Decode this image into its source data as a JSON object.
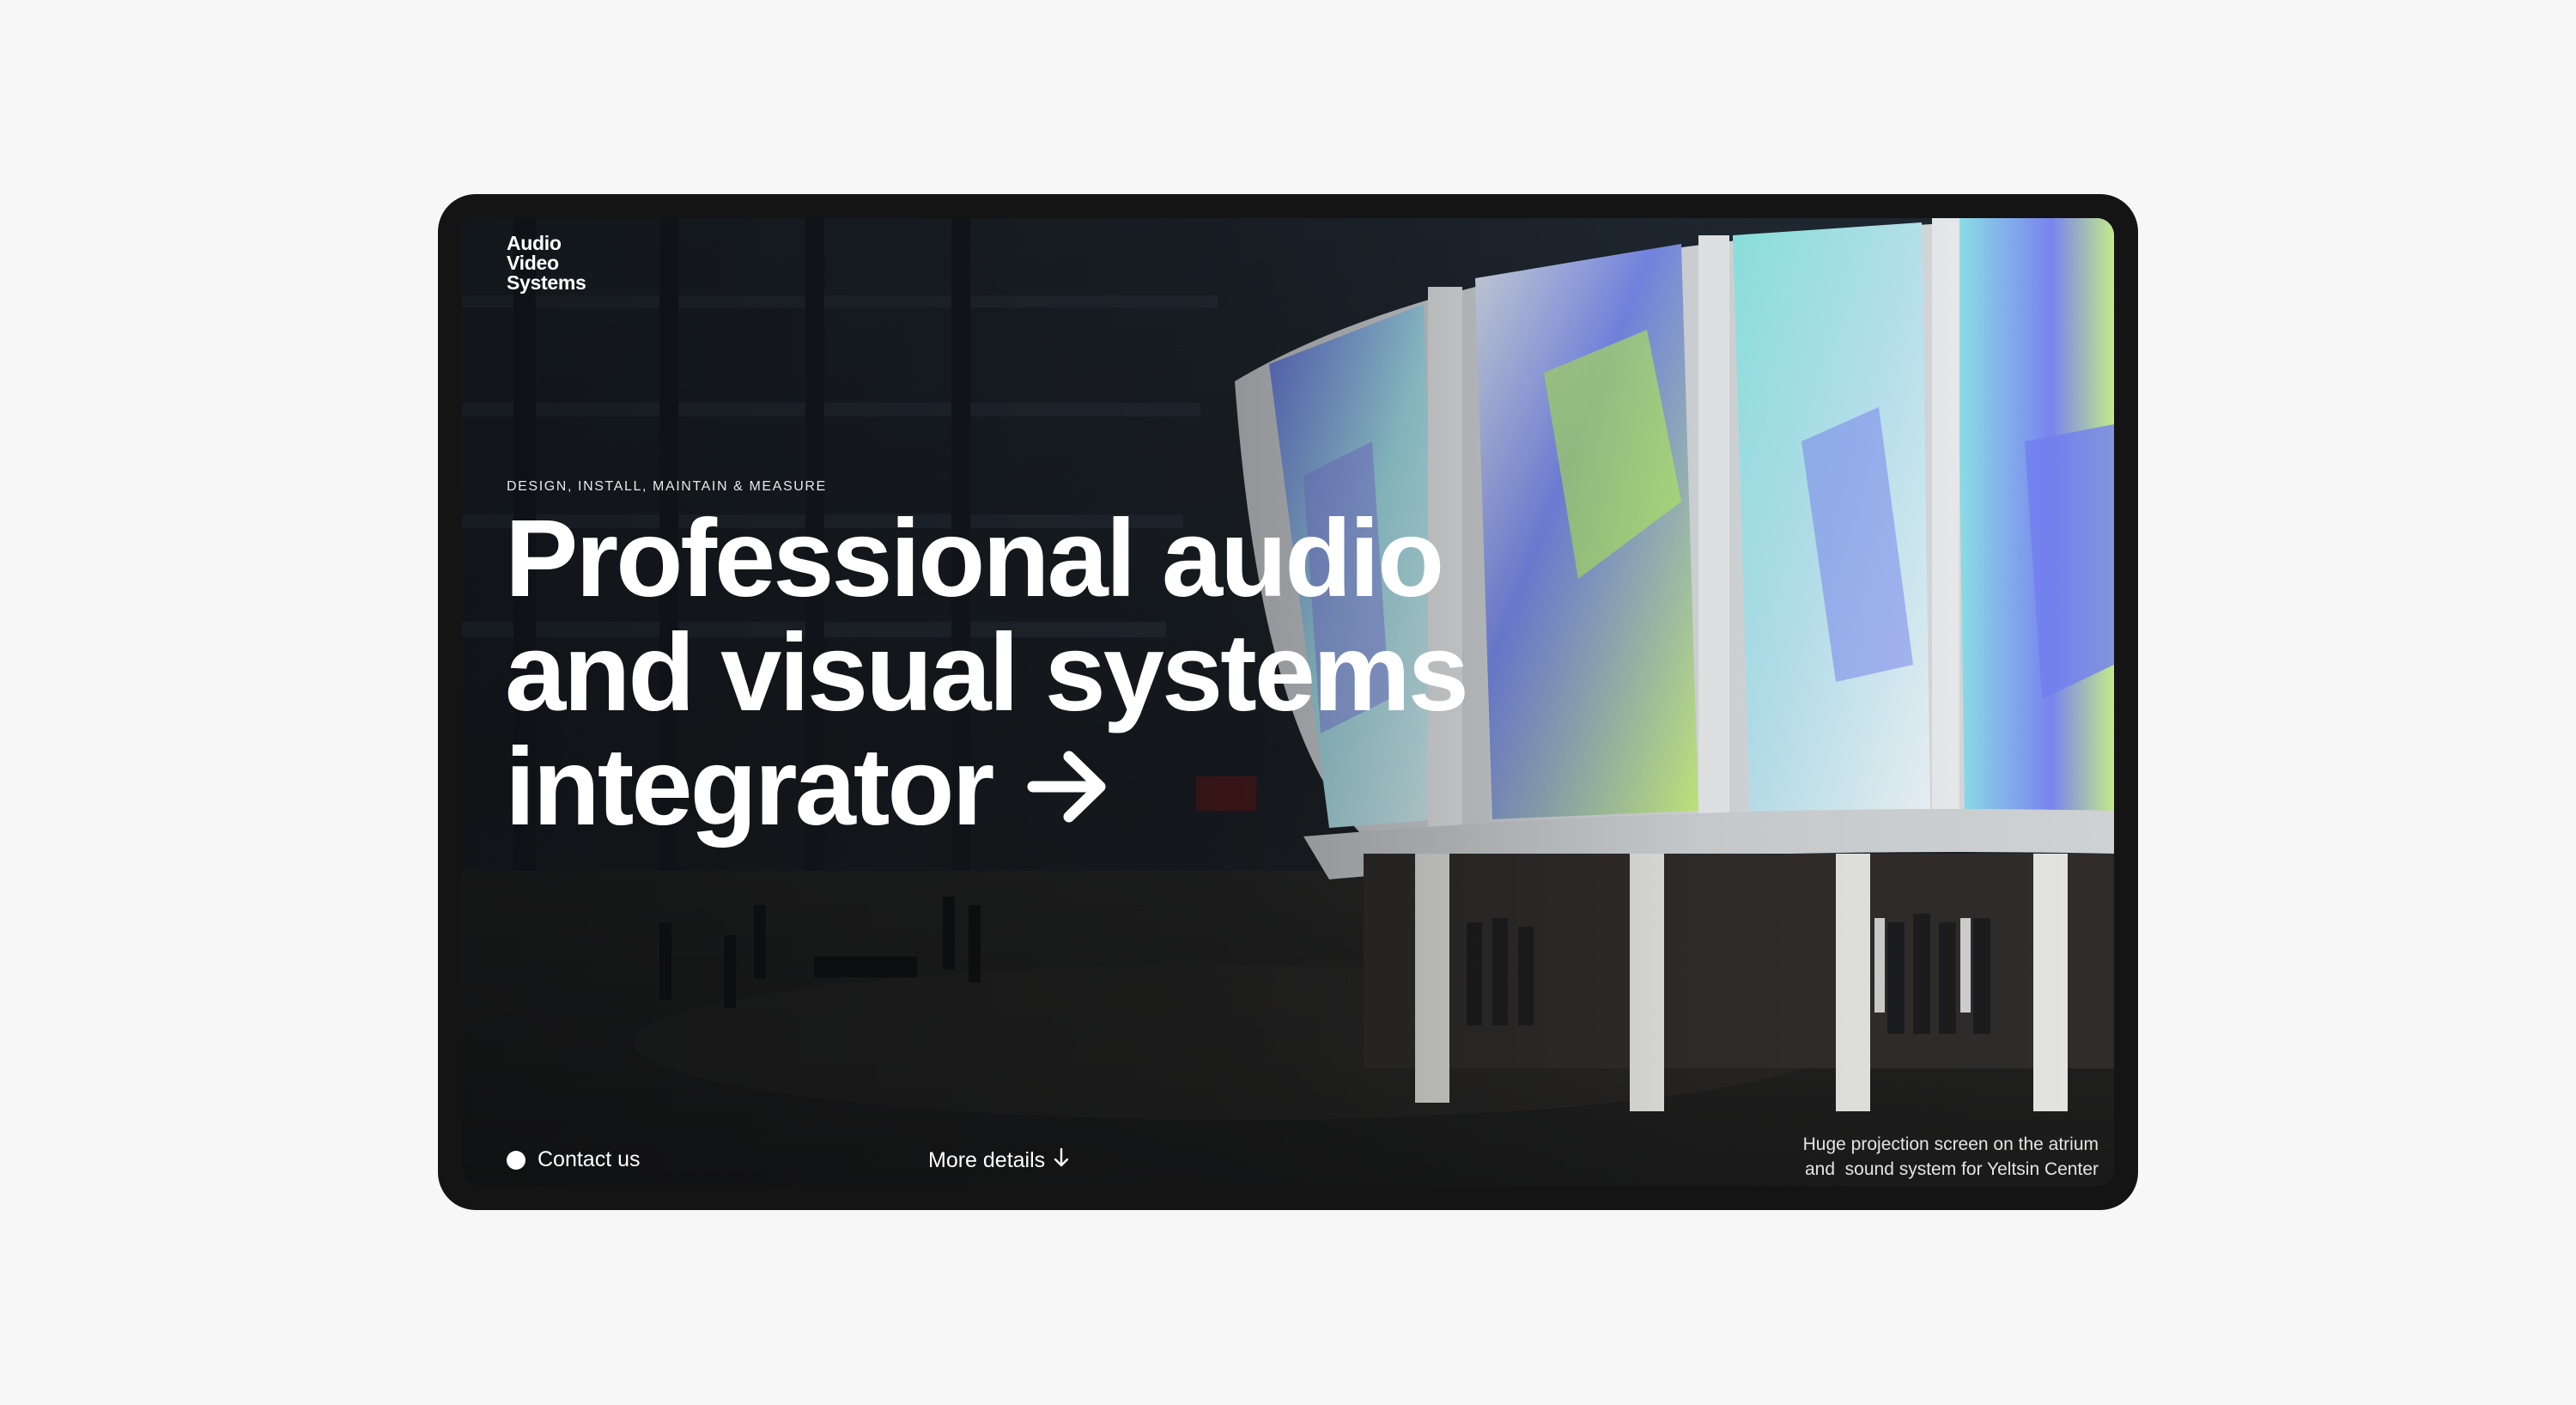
{
  "brand": {
    "logo_lines": [
      "Audio",
      "Video",
      "Systems"
    ]
  },
  "hero": {
    "kicker": "DESIGN, INSTALL, MAINTAIN & MEASURE",
    "headline_lines": [
      "Professional audio",
      "and visual systems",
      "integrator"
    ],
    "arrow_icon": "arrow-right-icon"
  },
  "actions": {
    "contact_label": "Contact us",
    "more_label": "More details",
    "more_icon": "arrow-down-icon"
  },
  "caption": {
    "lines": [
      "Huge projection screen on the atrium",
      "and  sound system for Yeltsin Center"
    ]
  },
  "colors": {
    "page_background": "#f7f7f7",
    "device_frame": "#141414",
    "text": "#ffffff"
  }
}
